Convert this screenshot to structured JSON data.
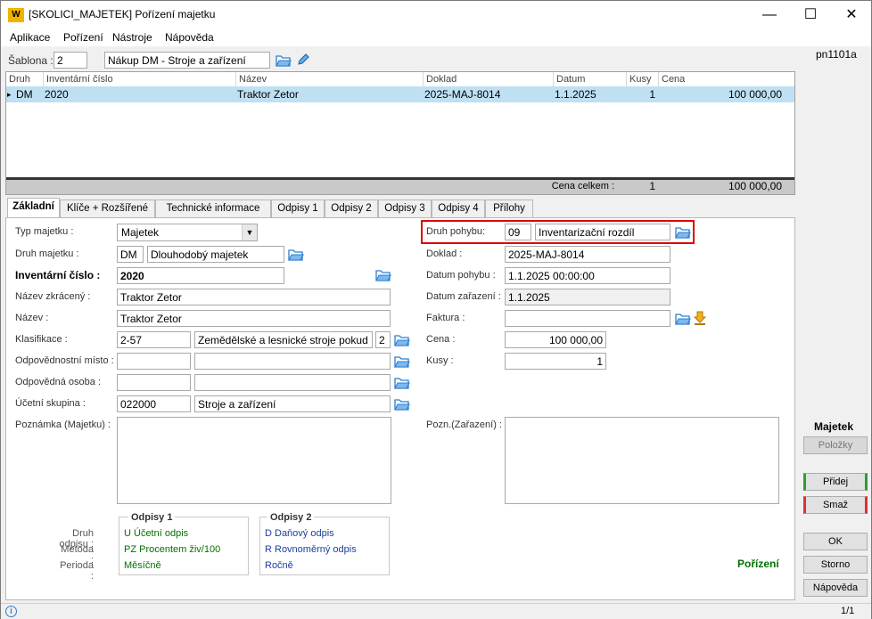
{
  "window": {
    "title": "[SKOLICI_MAJETEK] Pořízení majetku",
    "logo": "W"
  },
  "menu": [
    "Aplikace",
    "Pořízení",
    "Nástroje",
    "Nápověda"
  ],
  "sablona": {
    "label": "Šablona :",
    "code": "2",
    "name": "Nákup DM - Stroje a zařízení"
  },
  "grid": {
    "headers": [
      "Druh",
      "Inventární číslo",
      "Název",
      "Doklad",
      "Datum",
      "Kusy",
      "Cena"
    ],
    "row": {
      "marker": "▸",
      "druh": "DM",
      "inv": "2020",
      "nazev": "Traktor Zetor",
      "doklad": "2025-MAJ-8014",
      "datum": "1.1.2025",
      "kusy": "1",
      "cena": "100 000,00"
    },
    "footer": {
      "label": "Cena celkem :",
      "kusy": "1",
      "cena": "100 000,00"
    }
  },
  "tabs": [
    "Základní",
    "Klíče + Rozšířené",
    "Technické informace",
    "Odpisy 1",
    "Odpisy 2",
    "Odpisy 3",
    "Odpisy 4",
    "Přílohy"
  ],
  "form": {
    "typ_majetku": {
      "label": "Typ majetku :",
      "value": "Majetek"
    },
    "druh_majetku": {
      "label": "Druh majetku :",
      "code": "DM",
      "name": "Dlouhodobý majetek"
    },
    "inv_cislo": {
      "label": "Inventární číslo :",
      "value": "2020"
    },
    "nazev_zkr": {
      "label": "Název zkrácený :",
      "value": "Traktor Zetor"
    },
    "nazev": {
      "label": "Název :",
      "value": "Traktor Zetor"
    },
    "klasifikace": {
      "label": "Klasifikace :",
      "code": "2-57",
      "name": "Zemědělské a lesnické stroje pokud ne",
      "num": "2"
    },
    "odp_misto": {
      "label": "Odpovědnostní místo :"
    },
    "odp_osoba": {
      "label": "Odpovědná osoba :"
    },
    "ucetni_skupina": {
      "label": "Účetní skupina :",
      "code": "022000",
      "name": "Stroje a zařízení"
    },
    "poznamka": {
      "label": "Poznámka (Majetku) :"
    },
    "druh_pohybu": {
      "label": "Druh pohybu:",
      "code": "09",
      "name": "Inventarizační rozdíl"
    },
    "doklad": {
      "label": "Doklad :",
      "value": "2025-MAJ-8014"
    },
    "datum_pohybu": {
      "label": "Datum pohybu :",
      "value": "1.1.2025 00:00:00"
    },
    "datum_zarazeni": {
      "label": "Datum zařazení :",
      "value": "1.1.2025"
    },
    "faktura": {
      "label": "Faktura :"
    },
    "cena": {
      "label": "Cena :",
      "value": "100 000,00"
    },
    "kusy": {
      "label": "Kusy :",
      "value": "1"
    },
    "pozn_zarazeni": {
      "label": "Pozn.(Zařazení) :"
    }
  },
  "odpisy": {
    "labels": [
      "Druh odpisu :",
      "Metoda :",
      "Perioda :"
    ],
    "o1": {
      "title": "Odpisy 1",
      "druh": "U  Účetní odpis",
      "metoda": "PZ  Procentem živ/100",
      "perioda": "Měsíčně"
    },
    "o2": {
      "title": "Odpisy 2",
      "druh": "D  Daňový odpis",
      "metoda": "R  Rovnoměrný odpis",
      "perioda": "Ročně"
    }
  },
  "status_label": "Pořízení",
  "side": {
    "code": "pn1101a",
    "section": "Majetek",
    "polozky": "Položky",
    "pridej": "Přidej",
    "smaz": "Smaž",
    "ok": "OK",
    "storno": "Storno",
    "napoveda": "Nápověda"
  },
  "statusbar": {
    "page": "1/1"
  },
  "colors": {
    "selection": "#bfe0f3",
    "highlight": "#e00000",
    "green": "#007000",
    "folder": "#2a7fd4"
  }
}
